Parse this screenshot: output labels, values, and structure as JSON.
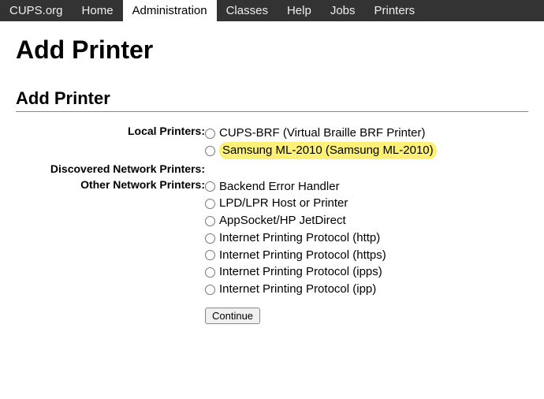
{
  "navbar": {
    "items": [
      {
        "label": "CUPS.org",
        "active": false
      },
      {
        "label": "Home",
        "active": false
      },
      {
        "label": "Administration",
        "active": true
      },
      {
        "label": "Classes",
        "active": false
      },
      {
        "label": "Help",
        "active": false
      },
      {
        "label": "Jobs",
        "active": false
      },
      {
        "label": "Printers",
        "active": false
      }
    ]
  },
  "page": {
    "title": "Add Printer",
    "section_title": "Add Printer"
  },
  "form": {
    "groups": {
      "local": {
        "label": "Local Printers:",
        "options": [
          {
            "label": "CUPS-BRF (Virtual Braille BRF Printer)",
            "highlight": false
          },
          {
            "label": "Samsung ML-2010 (Samsung ML-2010)",
            "highlight": true
          }
        ]
      },
      "discovered": {
        "label": "Discovered Network Printers:",
        "options": []
      },
      "other": {
        "label": "Other Network Printers:",
        "options": [
          {
            "label": "Backend Error Handler",
            "highlight": false
          },
          {
            "label": "LPD/LPR Host or Printer",
            "highlight": false
          },
          {
            "label": "AppSocket/HP JetDirect",
            "highlight": false
          },
          {
            "label": "Internet Printing Protocol (http)",
            "highlight": false
          },
          {
            "label": "Internet Printing Protocol (https)",
            "highlight": false
          },
          {
            "label": "Internet Printing Protocol (ipps)",
            "highlight": false
          },
          {
            "label": "Internet Printing Protocol (ipp)",
            "highlight": false
          }
        ]
      }
    },
    "continue_label": "Continue"
  }
}
